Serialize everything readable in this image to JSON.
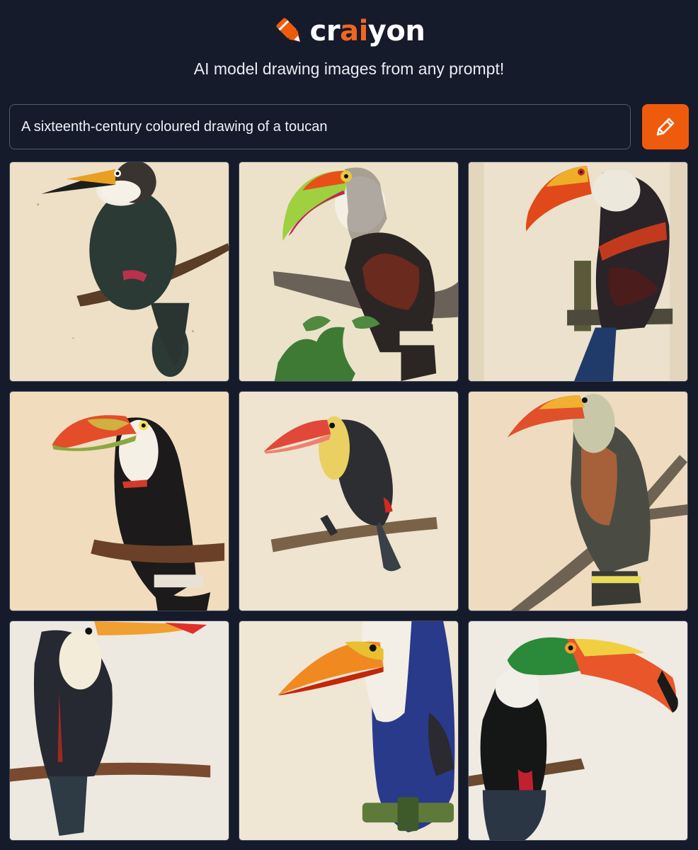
{
  "app": {
    "logo_prefix": "cr",
    "logo_accent": "ai",
    "logo_suffix": "yon",
    "brand_color": "#ef5b0c",
    "background_color": "#151b2b"
  },
  "header": {
    "tagline": "AI model drawing images from any prompt!"
  },
  "prompt": {
    "value": "A sixteenth-century coloured drawing of a toucan",
    "draw_button_icon": "pencil-icon"
  },
  "results": {
    "image_count": 9,
    "images": [
      {
        "subject": "toucan"
      },
      {
        "subject": "toucan"
      },
      {
        "subject": "toucan"
      },
      {
        "subject": "toucan"
      },
      {
        "subject": "toucan"
      },
      {
        "subject": "toucan"
      },
      {
        "subject": "toucan"
      },
      {
        "subject": "toucan"
      },
      {
        "subject": "toucan"
      }
    ]
  }
}
